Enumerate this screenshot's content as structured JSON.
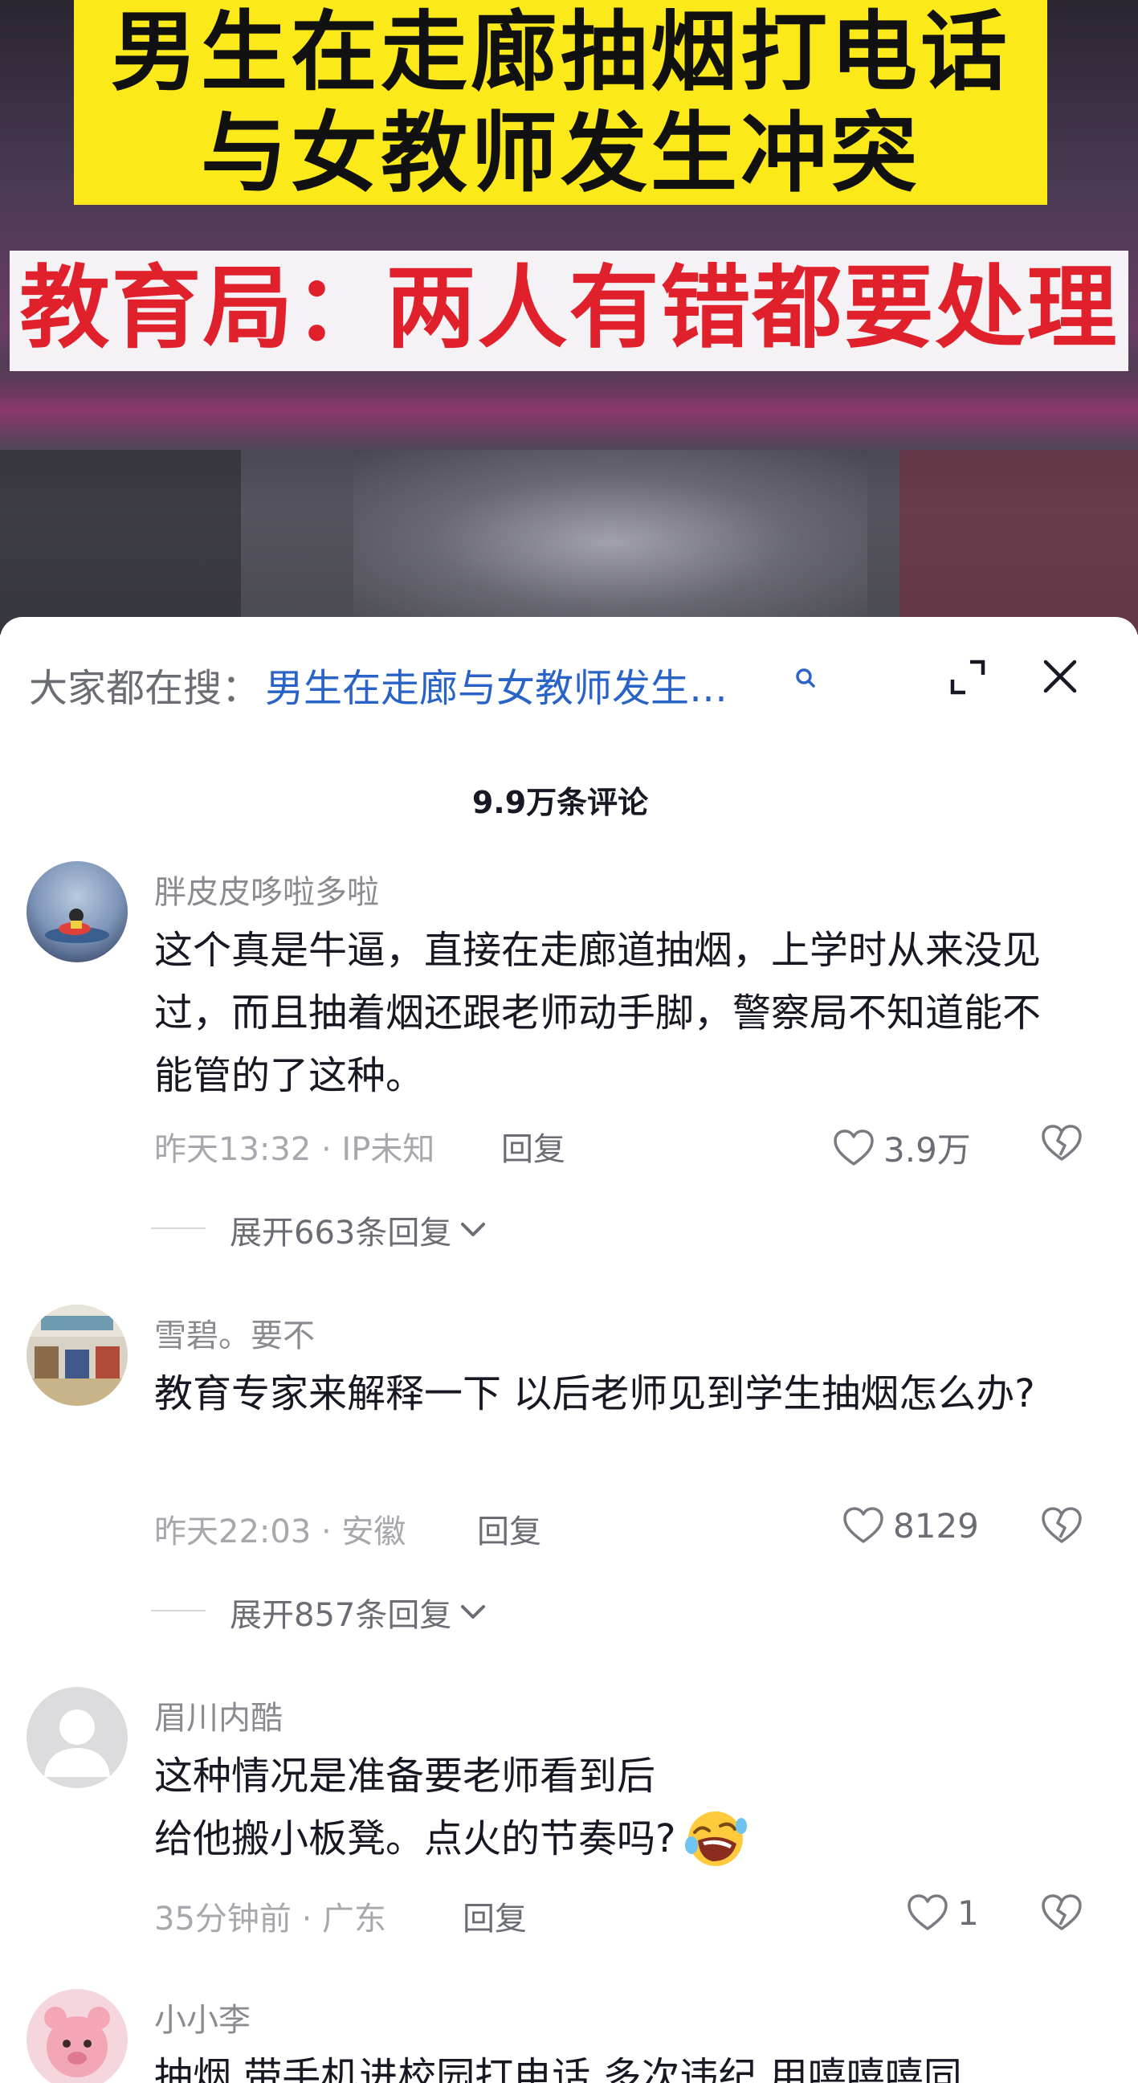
{
  "video": {
    "headline_line1": "男生在走廊抽烟打电话",
    "headline_line2": "与女教师发生冲突",
    "headline_line3": "教育局：两人有错都要处理"
  },
  "search": {
    "prefix": "大家都在搜：",
    "query": "男生在走廊与女教师发生…"
  },
  "comment_count": "9.9万条评论",
  "comments": [
    {
      "username": "胖皮皮哆啦多啦",
      "text": "这个真是牛逼，直接在走廊道抽烟，上学时从来没见过，而且抽着烟还跟老师动手脚，警察局不知道能不能管的了这种。",
      "meta": "昨天13:32 · IP未知",
      "reply": "回复",
      "likes": "3.9万",
      "expand": "展开663条回复"
    },
    {
      "username": "雪碧。要不",
      "text": "教育专家来解释一下 以后老师见到学生抽烟怎么办?",
      "meta": "昨天22:03 · 安徽",
      "reply": "回复",
      "likes": "8129",
      "expand": "展开857条回复"
    },
    {
      "username": "眉川内酷",
      "text_line1": "这种情况是准备要老师看到后",
      "text_line2": "给他搬小板凳。点火的节奏吗?",
      "meta": "35分钟前 · 广东",
      "reply": "回复",
      "likes": "1"
    },
    {
      "username": "小小李",
      "text": "抽烟 带手机进校园打电话 多次违纪 用嘻嘻嘻同"
    }
  ],
  "colors": {
    "banner_yellow": "#fbe91a",
    "banner_red_text": "#e0212b",
    "link_blue": "#2a63c8"
  }
}
